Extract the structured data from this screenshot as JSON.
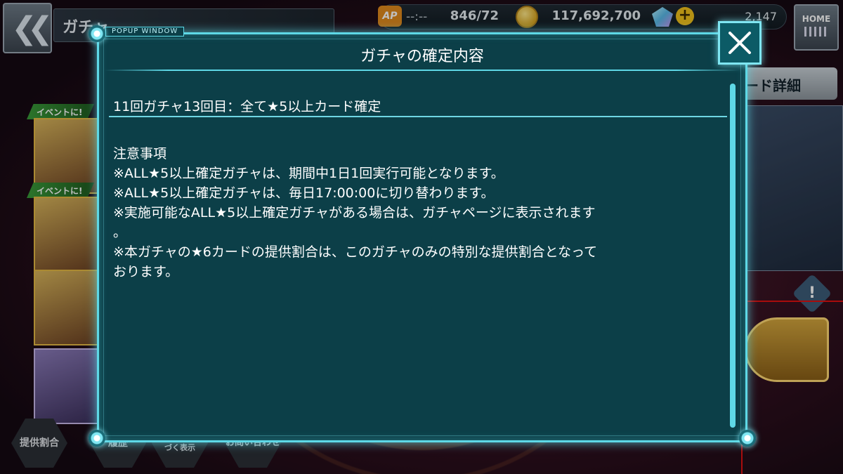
{
  "app": {
    "screen_title": "ガチャ"
  },
  "header": {
    "ap_label": "AP",
    "ap_timer": "--:--",
    "ap_value": "846/72",
    "coins": "117,692,700",
    "gems": "2,147",
    "home_label": "HOME"
  },
  "background": {
    "card_detail_label": "カード詳細",
    "event_tag_1": "イベントに!",
    "event_tag_2": "イベントに!",
    "info_icon": "!",
    "bottom_buttons": [
      "提供割合",
      "履歴",
      "資金決済法に基づく表示",
      "お問い合わせ"
    ]
  },
  "modal": {
    "popup_label": "POPUP WINDOW",
    "title": "ガチャの確定内容",
    "section_heading": "11回ガチャ13回目：全て★5以上カード確定",
    "notes": [
      "注意事項",
      "※ALL★5以上確定ガチャは、期間中1日1回実行可能となります。",
      "※ALL★5以上確定ガチャは、毎日17:00:00に切り替わります。",
      "※実施可能なALL★5以上確定ガチャがある場合は、ガチャページに表示されます",
      "。",
      "※本ガチャの★6カードの提供割合は、このガチャのみの特別な提供割合となって",
      "おります。"
    ]
  },
  "icons": {
    "back": "double-chevron-left-icon",
    "close": "close-icon",
    "coin": "coin-icon",
    "gem": "gem-icon",
    "plus": "plus-icon"
  },
  "colors": {
    "modal_bg": "#0c3f48",
    "modal_border": "#5ed8e6",
    "highlight_frame": "#e01010"
  }
}
